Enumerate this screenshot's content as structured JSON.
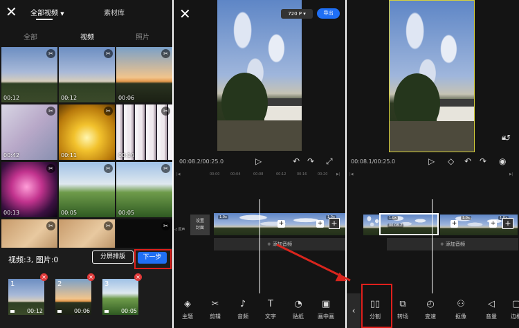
{
  "panel1": {
    "close_icon": "close-icon",
    "tab_all": "全部视频",
    "tab_library": "素材库",
    "filters": [
      "全部",
      "视频",
      "照片"
    ],
    "grid": [
      {
        "dur": "00:12",
        "style": "sky"
      },
      {
        "dur": "00:12",
        "style": "sky"
      },
      {
        "dur": "00:06",
        "style": "sunset"
      },
      {
        "dur": "00:42",
        "style": "phone"
      },
      {
        "dur": "00:11",
        "style": "golden"
      },
      {
        "dur": "00:14",
        "style": "glitch"
      },
      {
        "dur": "00:13",
        "style": "pinkfire"
      },
      {
        "dur": "00:05",
        "style": "greenfield"
      },
      {
        "dur": "00:05",
        "style": "greenfield"
      },
      {
        "dur": "",
        "style": "cat"
      },
      {
        "dur": "",
        "style": "cat"
      },
      {
        "dur": "",
        "style": "dark"
      }
    ],
    "count_text": "视频:3, 图片:0",
    "split_button": "分屏排版",
    "next_button": "下一步",
    "selected": [
      {
        "num": "1",
        "dur": "00:12"
      },
      {
        "num": "2",
        "dur": "00:06"
      },
      {
        "num": "3",
        "dur": "00:05"
      }
    ]
  },
  "panel2": {
    "resolution": "720 P",
    "export": "导出",
    "time": "00:08.2/00:25.0",
    "ruler": [
      "00:00",
      "00:04",
      "00:08",
      "00:12",
      "00:16",
      "00:20"
    ],
    "cover_label": "设置\n封面",
    "add_audio": "+ 添加音频",
    "speed_labels": [
      "1.0x",
      "1.0x",
      "1.0x"
    ],
    "tools": [
      {
        "label": "主题",
        "icon": "layers-icon",
        "glyph": "◈"
      },
      {
        "label": "剪辑",
        "icon": "scissors-icon",
        "glyph": "✂"
      },
      {
        "label": "音频",
        "icon": "music-icon",
        "glyph": "♪"
      },
      {
        "label": "文字",
        "icon": "text-icon",
        "glyph": "T"
      },
      {
        "label": "贴纸",
        "icon": "sticker-icon",
        "glyph": "◔"
      },
      {
        "label": "画中画",
        "icon": "pip-icon",
        "glyph": "▣"
      }
    ]
  },
  "panel3": {
    "time": "00:08.1/00:25.0",
    "clip_time": "00:08.2",
    "add_audio": "+ 添加音频",
    "speed_labels": [
      "1.0x",
      "1.0x",
      "1.0x"
    ],
    "tools": [
      {
        "label": "分割",
        "icon": "split-icon",
        "glyph": "▯▯"
      },
      {
        "label": "转场",
        "icon": "transition-icon",
        "glyph": "⧉"
      },
      {
        "label": "变速",
        "icon": "speed-icon",
        "glyph": "◴"
      },
      {
        "label": "抠像",
        "icon": "cutout-icon",
        "glyph": "⚇"
      },
      {
        "label": "音量",
        "icon": "volume-icon",
        "glyph": "◁"
      },
      {
        "label": "边框",
        "icon": "border-icon",
        "glyph": "▢"
      }
    ]
  },
  "colors": {
    "accent": "#1f6ff5",
    "highlight": "#e0201c",
    "delete": "#e03a3a"
  }
}
